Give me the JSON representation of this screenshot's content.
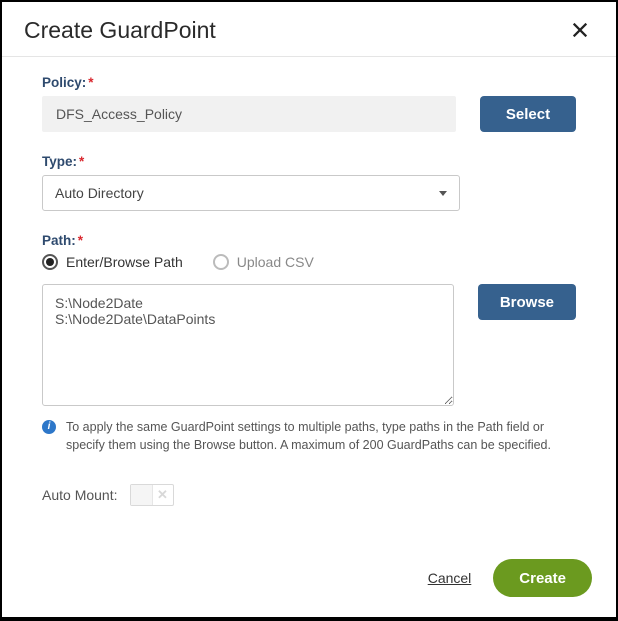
{
  "dialog": {
    "title": "Create GuardPoint"
  },
  "policy": {
    "label": "Policy:",
    "value": "DFS_Access_Policy",
    "select_button": "Select"
  },
  "type": {
    "label": "Type:",
    "value": "Auto Directory"
  },
  "path": {
    "label": "Path:",
    "radio_enter": "Enter/Browse Path",
    "radio_upload": "Upload CSV",
    "textarea_value": "S:\\Node2Date\nS:\\Node2Date\\DataPoints",
    "browse_button": "Browse",
    "info_text": "To apply the same GuardPoint settings to multiple paths, type paths in the Path field or specify them using the Browse button. A maximum of 200 GuardPaths can be specified."
  },
  "automount": {
    "label": "Auto Mount:"
  },
  "footer": {
    "cancel": "Cancel",
    "create": "Create"
  }
}
